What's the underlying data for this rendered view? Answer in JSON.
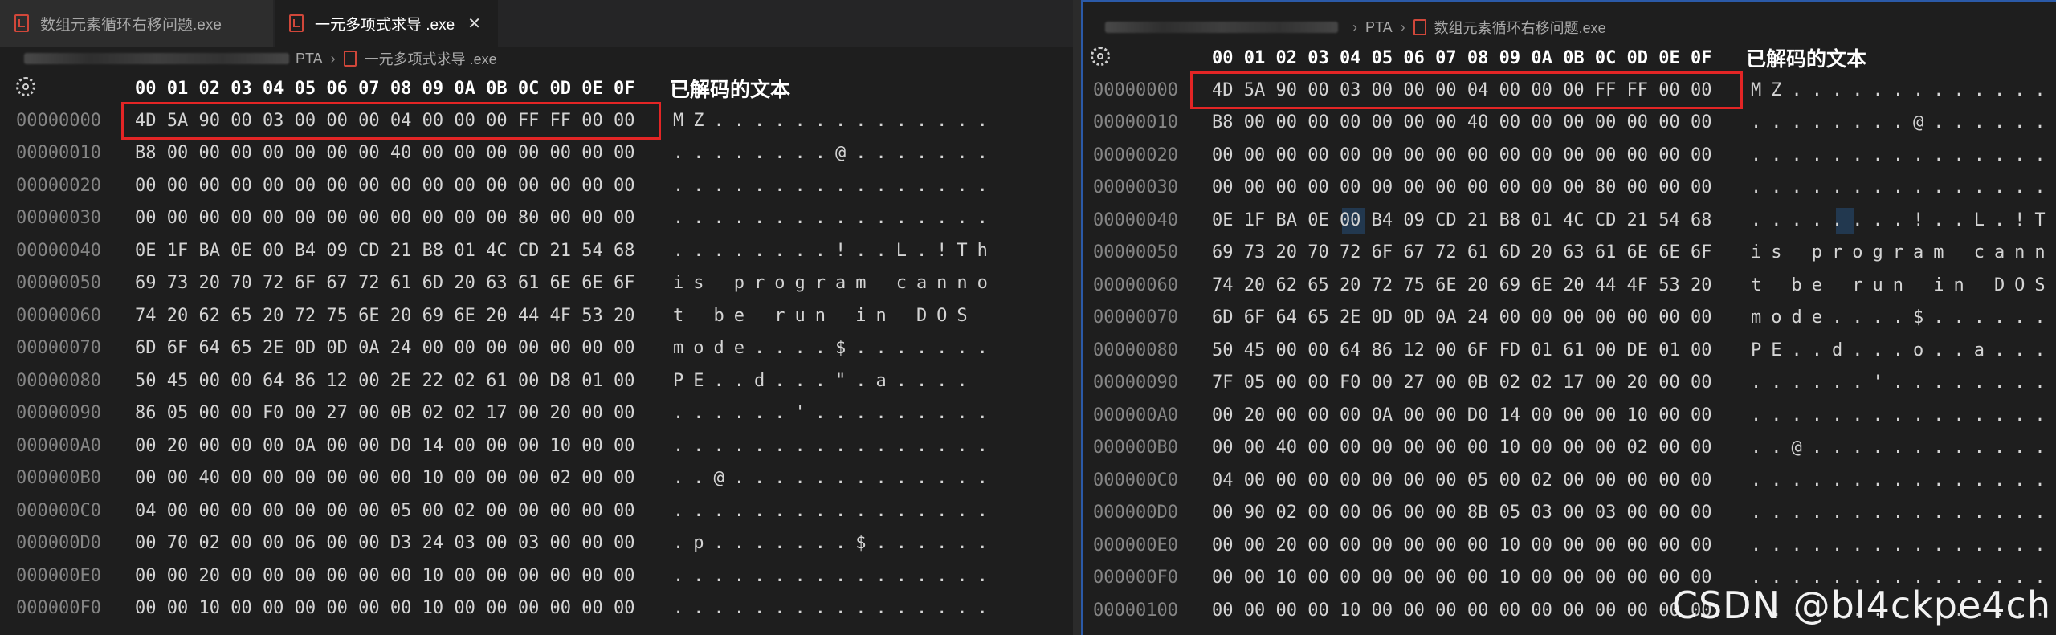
{
  "left": {
    "tabs": [
      {
        "label": "数组元素循环右移问题.exe",
        "active": false
      },
      {
        "label": "一元多项式求导 .exe",
        "active": true
      }
    ],
    "close_glyph": "✕",
    "breadcrumb": {
      "folder": "PTA",
      "file": "一元多项式求导 .exe"
    },
    "header_bytes": "00 01 02 03 04 05 06 07 08 09 0A 0B 0C 0D 0E 0F",
    "decoded_title": "已解码的文本",
    "rows": [
      {
        "addr": "00000000",
        "bytes": "4D 5A 90 00 03 00 00 00 04 00 00 00 FF FF 00 00",
        "text": "MZ.............."
      },
      {
        "addr": "00000010",
        "bytes": "B8 00 00 00 00 00 00 00 40 00 00 00 00 00 00 00",
        "text": "........@......."
      },
      {
        "addr": "00000020",
        "bytes": "00 00 00 00 00 00 00 00 00 00 00 00 00 00 00 00",
        "text": "................"
      },
      {
        "addr": "00000030",
        "bytes": "00 00 00 00 00 00 00 00 00 00 00 00 80 00 00 00",
        "text": "................"
      },
      {
        "addr": "00000040",
        "bytes": "0E 1F BA 0E 00 B4 09 CD 21 B8 01 4C CD 21 54 68",
        "text": "........!..L.!Th"
      },
      {
        "addr": "00000050",
        "bytes": "69 73 20 70 72 6F 67 72 61 6D 20 63 61 6E 6E 6F",
        "text": "is program canno"
      },
      {
        "addr": "00000060",
        "bytes": "74 20 62 65 20 72 75 6E 20 69 6E 20 44 4F 53 20",
        "text": "t be run in DOS "
      },
      {
        "addr": "00000070",
        "bytes": "6D 6F 64 65 2E 0D 0D 0A 24 00 00 00 00 00 00 00",
        "text": "mode....$......."
      },
      {
        "addr": "00000080",
        "bytes": "50 45 00 00 64 86 12 00 2E 22 02 61 00 D8 01 00",
        "text": "PE..d...\".a...."
      },
      {
        "addr": "00000090",
        "bytes": "86 05 00 00 F0 00 27 00 0B 02 02 17 00 20 00 00",
        "text": "......'........."
      },
      {
        "addr": "000000A0",
        "bytes": "00 20 00 00 00 0A 00 00 D0 14 00 00 00 10 00 00",
        "text": "................"
      },
      {
        "addr": "000000B0",
        "bytes": "00 00 40 00 00 00 00 00 00 10 00 00 00 02 00 00",
        "text": "..@............."
      },
      {
        "addr": "000000C0",
        "bytes": "04 00 00 00 00 00 00 00 05 00 02 00 00 00 00 00",
        "text": "................"
      },
      {
        "addr": "000000D0",
        "bytes": "00 70 02 00 00 06 00 00 D3 24 03 00 03 00 00 00",
        "text": ".p.......$......"
      },
      {
        "addr": "000000E0",
        "bytes": "00 00 20 00 00 00 00 00 00 10 00 00 00 00 00 00",
        "text": "................"
      },
      {
        "addr": "000000F0",
        "bytes": "00 00 10 00 00 00 00 00 00 10 00 00 00 00 00 00",
        "text": "................"
      }
    ]
  },
  "right": {
    "breadcrumb": {
      "folder": "PTA",
      "file": "数组元素循环右移问题.exe"
    },
    "header_bytes": "00 01 02 03 04 05 06 07 08 09 0A 0B 0C 0D 0E 0F",
    "decoded_title": "已解码的文本",
    "rows": [
      {
        "addr": "00000000",
        "bytes": "4D 5A 90 00 03 00 00 00 04 00 00 00 FF FF 00 00",
        "text": "MZ.............."
      },
      {
        "addr": "00000010",
        "bytes": "B8 00 00 00 00 00 00 00 40 00 00 00 00 00 00 00",
        "text": "........@......."
      },
      {
        "addr": "00000020",
        "bytes": "00 00 00 00 00 00 00 00 00 00 00 00 00 00 00 00",
        "text": "................"
      },
      {
        "addr": "00000030",
        "bytes": "00 00 00 00 00 00 00 00 00 00 00 00 80 00 00 00",
        "text": "................"
      },
      {
        "addr": "00000040",
        "bytes": "0E 1F BA 0E 00 B4 09 CD 21 B8 01 4C CD 21 54 68",
        "text": "........!..L.!Th"
      },
      {
        "addr": "00000050",
        "bytes": "69 73 20 70 72 6F 67 72 61 6D 20 63 61 6E 6E 6F",
        "text": "is program canno"
      },
      {
        "addr": "00000060",
        "bytes": "74 20 62 65 20 72 75 6E 20 69 6E 20 44 4F 53 20",
        "text": "t be run in DOS "
      },
      {
        "addr": "00000070",
        "bytes": "6D 6F 64 65 2E 0D 0D 0A 24 00 00 00 00 00 00 00",
        "text": "mode....$......."
      },
      {
        "addr": "00000080",
        "bytes": "50 45 00 00 64 86 12 00 6F FD 01 61 00 DE 01 00",
        "text": "PE..d...o..a...."
      },
      {
        "addr": "00000090",
        "bytes": "7F 05 00 00 F0 00 27 00 0B 02 02 17 00 20 00 00",
        "text": "......'........."
      },
      {
        "addr": "000000A0",
        "bytes": "00 20 00 00 00 0A 00 00 D0 14 00 00 00 10 00 00",
        "text": "................"
      },
      {
        "addr": "000000B0",
        "bytes": "00 00 40 00 00 00 00 00 00 10 00 00 00 02 00 00",
        "text": "..@............."
      },
      {
        "addr": "000000C0",
        "bytes": "04 00 00 00 00 00 00 00 05 00 02 00 00 00 00 00",
        "text": "................"
      },
      {
        "addr": "000000D0",
        "bytes": "00 90 02 00 00 06 00 00 8B 05 03 00 03 00 00 00",
        "text": "................"
      },
      {
        "addr": "000000E0",
        "bytes": "00 00 20 00 00 00 00 00 00 10 00 00 00 00 00 00",
        "text": "................"
      },
      {
        "addr": "000000F0",
        "bytes": "00 00 10 00 00 00 00 00 00 10 00 00 00 00 00 00",
        "text": "................"
      },
      {
        "addr": "00000100",
        "bytes": "00 00 00 00 10 00 00 00 00 00 00 00 00 00 00 00",
        "text": "................"
      }
    ]
  },
  "watermark": "CSDN @bl4ckpe4ch",
  "colors": {
    "highlight_box": "#e32525",
    "editor_bg": "#1e1e1e",
    "address": "#858585",
    "bytes": "#d4d4d4"
  }
}
